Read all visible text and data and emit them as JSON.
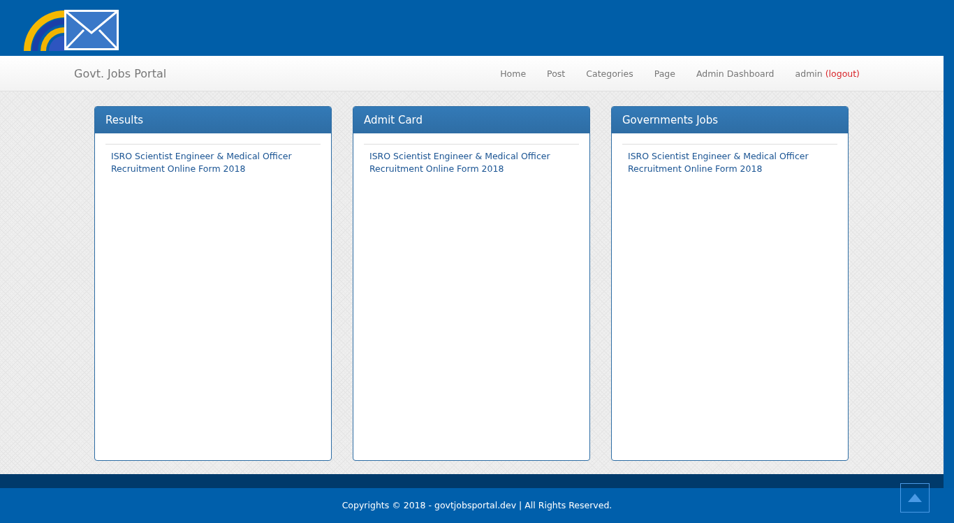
{
  "navbar": {
    "brand": "Govt. Jobs Portal",
    "items": [
      "Home",
      "Post",
      "Categories",
      "Page",
      "Admin Dashboard"
    ],
    "user": {
      "name": "admin",
      "logout": "(logout)"
    }
  },
  "panels": [
    {
      "title": "Results",
      "links": [
        "ISRO Scientist Engineer & Medical Officer Recruitment Online Form 2018"
      ]
    },
    {
      "title": "Admit Card",
      "links": [
        "ISRO Scientist Engineer & Medical Officer Recruitment Online Form 2018"
      ]
    },
    {
      "title": "Governments Jobs",
      "links": [
        "ISRO Scientist Engineer & Medical Officer Recruitment Online Form 2018"
      ]
    }
  ],
  "footer": {
    "text": "Copyrights © 2018 - govtjobsportal.dev | All Rights Reserved."
  }
}
